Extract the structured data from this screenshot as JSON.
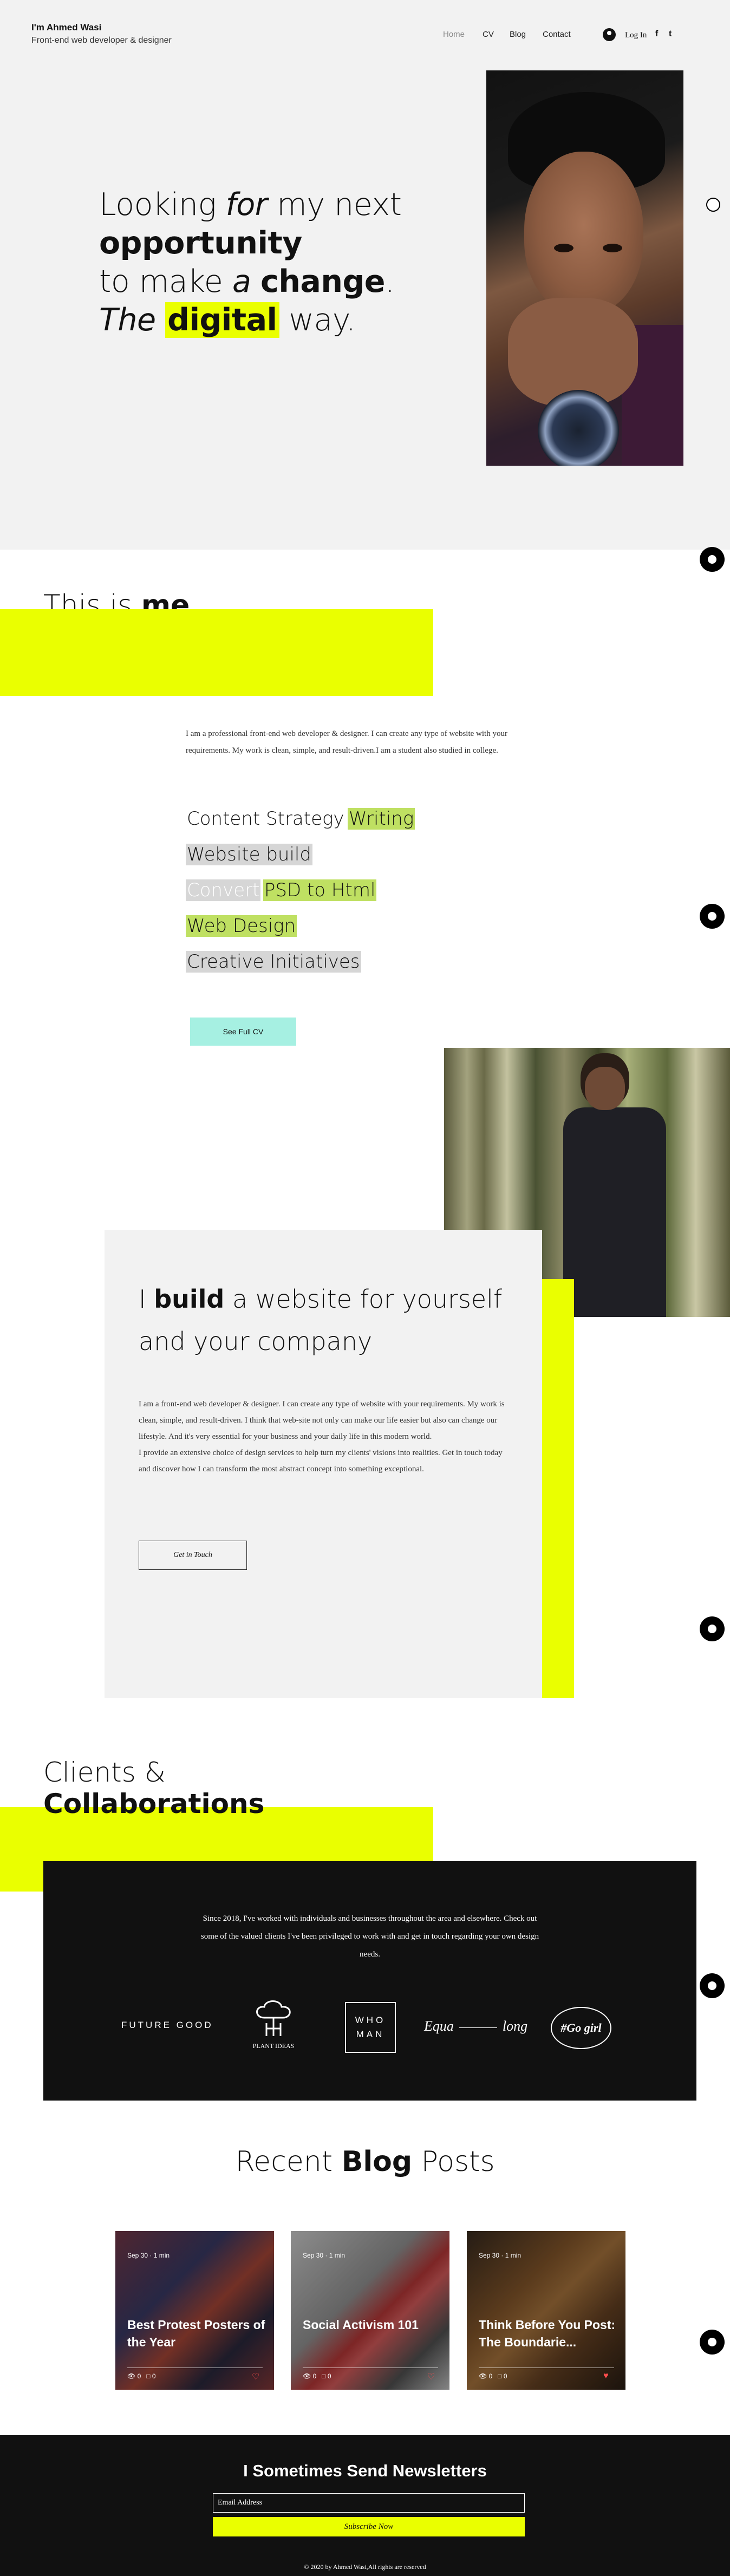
{
  "header": {
    "site_name": "I'm Ahmed Wasi",
    "tagline": "Front-end web developer & designer",
    "nav": [
      "Home",
      "CV",
      "Blog",
      "Contact"
    ],
    "login": "Log In",
    "social": {
      "facebook": "f",
      "twitter": "t"
    }
  },
  "hero": {
    "line1_a": "Looking ",
    "line1_b": "for",
    "line1_c": " my next",
    "line2": "opportunity",
    "line3_a": "to make ",
    "line3_b": "a",
    "line3_c": "change",
    "line3_d": ".",
    "line4_a": "The",
    "line4_b": "digital",
    "line4_c": " way."
  },
  "about": {
    "title_a": "This is ",
    "title_b": "me",
    "text": "I am a professional front-end web developer & designer. I can create any type of website with your requirements. My work is clean, simple, and result-driven.I am a student also studied in college.",
    "skills": {
      "content_strategy": "Content Strategy",
      "writing": "Writing",
      "website_build": "Website build",
      "convert": "Convert",
      "psd": "PSD to Html",
      "web_design": "Web Design",
      "creative": "Creative Initiatives"
    },
    "cv_button": "See Full CV"
  },
  "build": {
    "title_a": "I ",
    "title_b": "build",
    "title_c": " a website for yourself",
    "title_d": "and your company",
    "text1": "I am a front-end web developer & designer. I can create any type of website with your requirements. My work is clean, simple, and result-driven. I think that web-site not only can make our life easier but also can change our lifestyle. And it's very essential for your business and your daily life in this modern world.",
    "text2": "I provide an extensive choice of design services to help turn my clients' visions into realities. Get in touch today and discover how I can transform the most abstract concept into something exceptional.",
    "button": "Get in Touch"
  },
  "clients": {
    "title_a": "Clients &",
    "title_b": "Collaborations",
    "text": "Since 2018, I've worked with individuals and businesses throughout the area and elsewhere. Check out some of the valued clients I've been privileged to work with and get in touch regarding your own design needs.",
    "logos": {
      "future_good": "FUTURE GOOD",
      "plant_ideas": "PLANT IDEAS",
      "who_man_1": "WHO",
      "who_man_2": "MAN",
      "equa": "Equa",
      "long": "long",
      "go_girl": "#Go girl"
    }
  },
  "blog": {
    "title_a": "Recent ",
    "title_b": "Blog",
    "title_c": " Posts",
    "posts": [
      {
        "title": "Best Protest Posters of the Year",
        "meta": "Sep 30  ·  1 min",
        "views": "0",
        "comments": "0"
      },
      {
        "title": "Social Activism 101",
        "meta": "Sep 30  ·  1 min",
        "views": "0",
        "comments": "0"
      },
      {
        "title": "Think Before You Post: The Boundarie...",
        "meta": "Sep 30  ·  1 min",
        "views": "0",
        "comments": "0"
      }
    ]
  },
  "footer": {
    "title": "I Sometimes Send Newsletters",
    "email_placeholder": "Email Address",
    "subscribe": "Subscribe Now",
    "copyright": "© 2020 by Ahmed Wasi,All rights are reserved"
  },
  "colors": {
    "accent_yellow": "#eaff00",
    "skill_green": "#bfe062",
    "cv_button": "#a6f0e2"
  }
}
